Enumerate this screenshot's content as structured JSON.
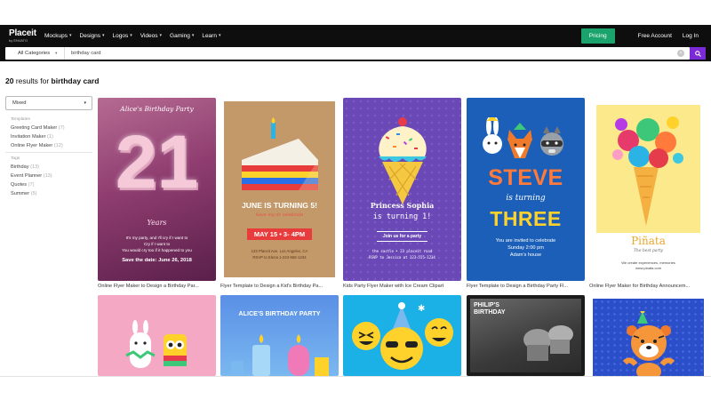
{
  "brand": {
    "name": "Placeit",
    "byline": "by ENVATO"
  },
  "nav": {
    "items": [
      {
        "label": "Mockups"
      },
      {
        "label": "Designs"
      },
      {
        "label": "Logos"
      },
      {
        "label": "Videos"
      },
      {
        "label": "Gaming"
      },
      {
        "label": "Learn"
      }
    ],
    "pricing": "Pricing",
    "free_account": "Free Account",
    "login": "Log In"
  },
  "search": {
    "category": "All Categories",
    "query": "birthday card"
  },
  "results": {
    "count": "20",
    "mid": "results for",
    "term": "birthday card"
  },
  "sidebar": {
    "sort": "Mixed",
    "templates_title": "Templates",
    "templates": [
      {
        "label": "Greeting Card Maker",
        "count": "(7)"
      },
      {
        "label": "Invitation Maker",
        "count": "(1)"
      },
      {
        "label": "Online Flyer Maker",
        "count": "(12)"
      }
    ],
    "tags_title": "Tags",
    "tags": [
      {
        "label": "Birthday",
        "count": "(13)"
      },
      {
        "label": "Event Planner",
        "count": "(13)"
      },
      {
        "label": "Quotes",
        "count": "(7)"
      },
      {
        "label": "Summer",
        "count": "(5)"
      }
    ]
  },
  "cards": [
    {
      "caption": "Online Flyer Maker to Design a Birthday Par...",
      "title": "Alice's Birthday Party",
      "number": "21",
      "sub": "Years",
      "line1": "It's my party, and I'll cry if I want to",
      "line2": "Cry if I want to",
      "line3": "You would cry too if it happened to you",
      "date": "Save the date: June 26, 2018"
    },
    {
      "caption": "Flyer Template to Design a Kid's Birthday Pa...",
      "heading": "JUNE IS TURNING 5!",
      "sub": "Save my dr celebrate",
      "date": "MAY 15 • 3- 4PM",
      "addr1": "123 Placeit Ave. Los Angeles, CA",
      "addr2": "RSVP to Elena 1-234-555-1234"
    },
    {
      "caption": "Kids Party Flyer Maker with Ice Cream Clipart",
      "name": "Princess Sophia",
      "turning": "is turning 1!",
      "join": "Join us for a party",
      "l1": "the castle • 23 placeit road",
      "l2": "RSVP to Jessica at 123-555-1234"
    },
    {
      "caption": "Flyer Template to Design a Birthday Party Fl...",
      "name": "STEVE",
      "turning": "is turning",
      "age": "THREE",
      "l1": "You are invited to celebrate",
      "l2": "Sunday 2:00 pm",
      "l3": "Adam's house"
    },
    {
      "caption": "Online Flyer Maker for Birthday Announcem...",
      "name": "Piñata",
      "sub": "The best party",
      "l1": "We create experiences, memories",
      "l2": "www.pinata.com"
    },
    {
      "caption": ""
    },
    {
      "caption": "",
      "title": "ALICE'S BIRTHDAY PARTY"
    },
    {
      "caption": ""
    },
    {
      "caption": "",
      "title": "PHILIP'S BIRTHDAY"
    },
    {
      "caption": ""
    }
  ],
  "colors": {
    "nav_bg": "#0e0e0e",
    "pricing_bg": "#1aa36a",
    "search_btn": "#7a2bd6"
  }
}
